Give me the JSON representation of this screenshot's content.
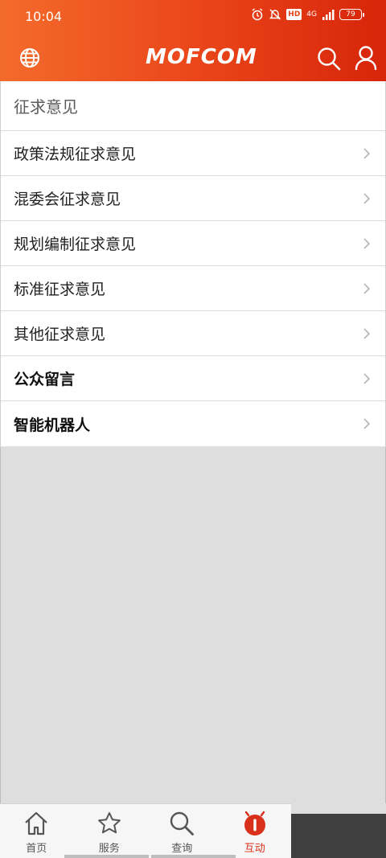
{
  "status_bar": {
    "time": "10:04",
    "network": "4G",
    "battery": "79"
  },
  "header": {
    "logo": "MOFCOM"
  },
  "list": {
    "section_title": "征求意见",
    "items": [
      {
        "label": "政策法规征求意见",
        "bold": false
      },
      {
        "label": "混委会征求意见",
        "bold": false
      },
      {
        "label": "规划编制征求意见",
        "bold": false
      },
      {
        "label": "标准征求意见",
        "bold": false
      },
      {
        "label": "其他征求意见",
        "bold": false
      },
      {
        "label": "公众留言",
        "bold": true
      },
      {
        "label": "智能机器人",
        "bold": true
      }
    ]
  },
  "tabbar": {
    "tabs": [
      {
        "label": "首页",
        "icon": "home-icon",
        "active": false
      },
      {
        "label": "服务",
        "icon": "star-icon",
        "active": false
      },
      {
        "label": "查询",
        "icon": "search-icon",
        "active": false
      },
      {
        "label": "互动",
        "icon": "interaction-icon",
        "active": true
      }
    ]
  },
  "colors": {
    "accent": "#d8301a",
    "header_start": "#f36b2b",
    "header_end": "#d72509",
    "background": "#dedede"
  }
}
